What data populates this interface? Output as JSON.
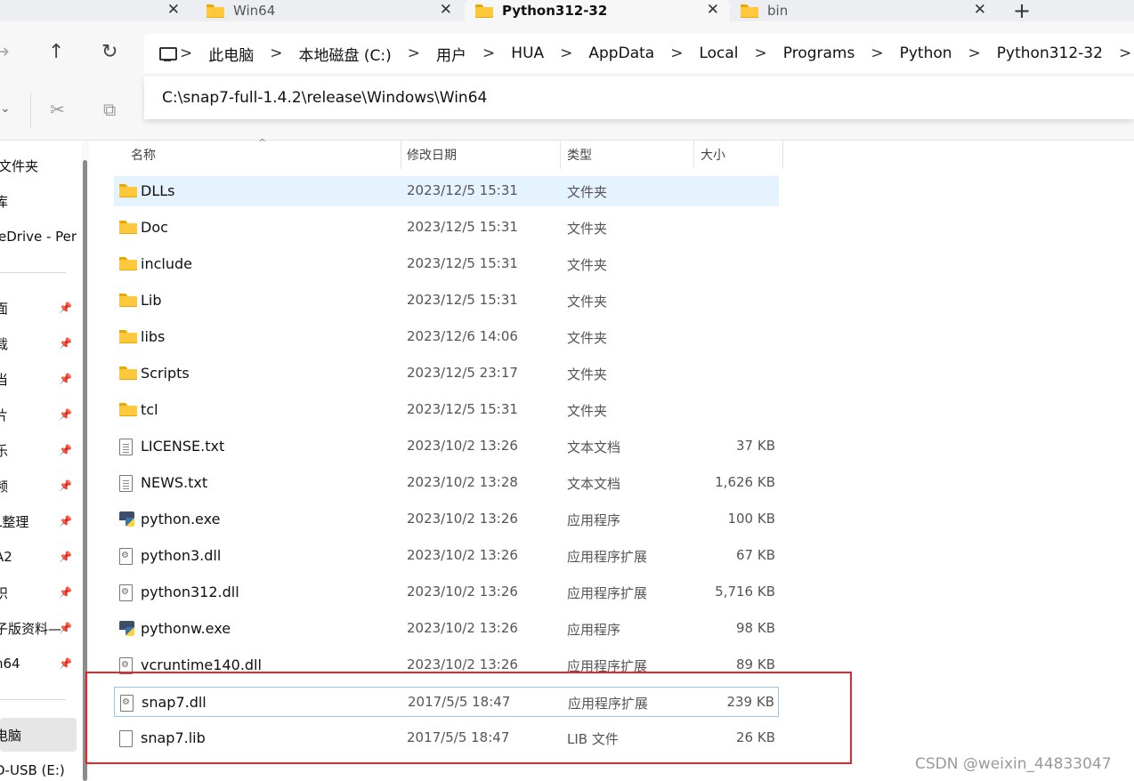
{
  "tabs": [
    {
      "label": "",
      "active": false
    },
    {
      "label": "Win64",
      "active": false
    },
    {
      "label": "Python312-32",
      "active": true
    },
    {
      "label": "bin",
      "active": false
    }
  ],
  "tab_close_glyph": "✕",
  "new_tab_glyph": "+",
  "nav": {
    "back_glyph": "→",
    "up_glyph": "↑",
    "refresh_glyph": "↻"
  },
  "breadcrumb": {
    "separator": ">",
    "items": [
      "此电脑",
      "本地磁盘 (C:)",
      "用户",
      "HUA",
      "AppData",
      "Local",
      "Programs",
      "Python",
      "Python312-32"
    ]
  },
  "address_dropdown": "C:\\snap7-full-1.4.2\\release\\Windows\\Win64",
  "toolbar": {
    "cut_icon": "scissors-icon",
    "copy_icon": "copy-icon"
  },
  "sidebar": {
    "items": [
      {
        "label": "文件夹",
        "pinned": false
      },
      {
        "label": "库",
        "pinned": false
      },
      {
        "label": "eDrive - Per",
        "pinned": false
      },
      {
        "label": "面",
        "pinned": true
      },
      {
        "label": "载",
        "pinned": true
      },
      {
        "label": "当",
        "pinned": true
      },
      {
        "label": "片",
        "pinned": true
      },
      {
        "label": "乐",
        "pinned": true
      },
      {
        "label": "频",
        "pinned": true
      },
      {
        "label": "L整理",
        "pinned": true
      },
      {
        "label": "A2",
        "pinned": true
      },
      {
        "label": "识",
        "pinned": true
      },
      {
        "label": "子版资料—",
        "pinned": true
      },
      {
        "label": "n64",
        "pinned": true
      },
      {
        "label": "电脑",
        "pinned": false,
        "selected": true
      },
      {
        "label": "D-USB (E:)",
        "pinned": false
      }
    ],
    "pin_glyph": "📌"
  },
  "columns": {
    "name": "名称",
    "date": "修改日期",
    "type": "类型",
    "size": "大小"
  },
  "files": [
    {
      "name": "DLLs",
      "date": "2023/12/5 15:31",
      "type": "文件夹",
      "size": "",
      "icon": "folder-icon",
      "selected": true
    },
    {
      "name": "Doc",
      "date": "2023/12/5 15:31",
      "type": "文件夹",
      "size": "",
      "icon": "folder-icon"
    },
    {
      "name": "include",
      "date": "2023/12/5 15:31",
      "type": "文件夹",
      "size": "",
      "icon": "folder-icon"
    },
    {
      "name": "Lib",
      "date": "2023/12/5 15:31",
      "type": "文件夹",
      "size": "",
      "icon": "folder-icon"
    },
    {
      "name": "libs",
      "date": "2023/12/6 14:06",
      "type": "文件夹",
      "size": "",
      "icon": "folder-icon"
    },
    {
      "name": "Scripts",
      "date": "2023/12/5 23:17",
      "type": "文件夹",
      "size": "",
      "icon": "folder-icon"
    },
    {
      "name": "tcl",
      "date": "2023/12/5 15:31",
      "type": "文件夹",
      "size": "",
      "icon": "folder-icon"
    },
    {
      "name": "LICENSE.txt",
      "date": "2023/10/2 13:26",
      "type": "文本文档",
      "size": "37 KB",
      "icon": "text-file-icon"
    },
    {
      "name": "NEWS.txt",
      "date": "2023/10/2 13:28",
      "type": "文本文档",
      "size": "1,626 KB",
      "icon": "text-file-icon"
    },
    {
      "name": "python.exe",
      "date": "2023/10/2 13:26",
      "type": "应用程序",
      "size": "100 KB",
      "icon": "python-exe-icon"
    },
    {
      "name": "python3.dll",
      "date": "2023/10/2 13:26",
      "type": "应用程序扩展",
      "size": "67 KB",
      "icon": "dll-file-icon"
    },
    {
      "name": "python312.dll",
      "date": "2023/10/2 13:26",
      "type": "应用程序扩展",
      "size": "5,716 KB",
      "icon": "dll-file-icon"
    },
    {
      "name": "pythonw.exe",
      "date": "2023/10/2 13:26",
      "type": "应用程序",
      "size": "98 KB",
      "icon": "python-exe-icon"
    },
    {
      "name": "vcruntime140.dll",
      "date": "2023/10/2 13:26",
      "type": "应用程序扩展",
      "size": "89 KB",
      "icon": "dll-file-icon"
    },
    {
      "name": "snap7.dll",
      "date": "2017/5/5 18:47",
      "type": "应用程序扩展",
      "size": "239 KB",
      "icon": "dll-file-icon",
      "outlined": true
    },
    {
      "name": "snap7.lib",
      "date": "2017/5/5 18:47",
      "type": "LIB 文件",
      "size": "26 KB",
      "icon": "file-icon"
    }
  ],
  "highlight_color": "#e0282d",
  "watermark": "CSDN @weixin_44833047"
}
